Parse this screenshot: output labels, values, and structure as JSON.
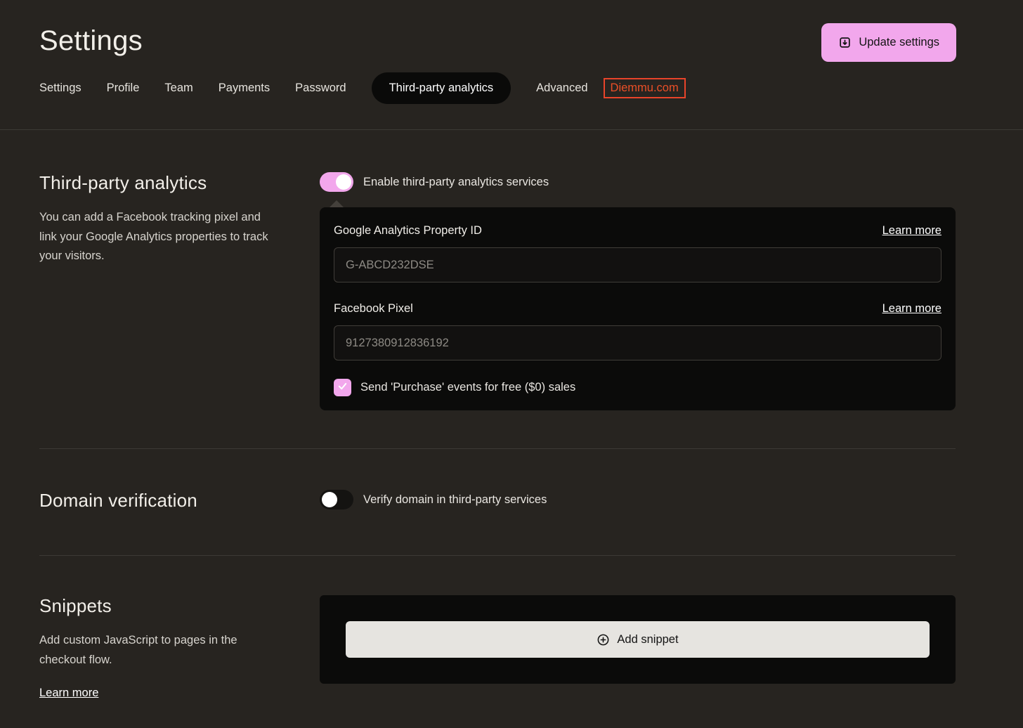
{
  "page": {
    "title": "Settings"
  },
  "header": {
    "update_button": {
      "label": "Update settings"
    }
  },
  "tabs": [
    {
      "label": "Settings",
      "active": false
    },
    {
      "label": "Profile",
      "active": false
    },
    {
      "label": "Team",
      "active": false
    },
    {
      "label": "Payments",
      "active": false
    },
    {
      "label": "Password",
      "active": false
    },
    {
      "label": "Third-party analytics",
      "active": true
    },
    {
      "label": "Advanced",
      "active": false
    },
    {
      "label": "Diemmu.com",
      "active": false,
      "highlighted": true
    }
  ],
  "sections": {
    "analytics": {
      "heading": "Third-party analytics",
      "description": "You can add a Facebook tracking pixel and link your Google Analytics properties to track your visitors.",
      "toggle_label": "Enable third-party analytics services",
      "toggle_on": true,
      "fields": [
        {
          "label": "Google Analytics Property ID",
          "learn_more": "Learn more",
          "placeholder": "G-ABCD232DSE",
          "value": ""
        },
        {
          "label": "Facebook Pixel",
          "learn_more": "Learn more",
          "placeholder": "9127380912836192",
          "value": ""
        }
      ],
      "checkbox_label": "Send 'Purchase' events for free ($0) sales",
      "checkbox_checked": true
    },
    "domain": {
      "heading": "Domain verification",
      "toggle_label": "Verify domain in third-party services",
      "toggle_on": false
    },
    "snippets": {
      "heading": "Snippets",
      "description": "Add custom JavaScript to pages in the checkout flow.",
      "learn_more": "Learn more",
      "add_button_label": "Add snippet"
    }
  },
  "colors": {
    "accent_pink": "#f2a7ec",
    "annotation_red": "#e8442a",
    "panel_black": "#0b0b0a",
    "background": "#272420"
  }
}
